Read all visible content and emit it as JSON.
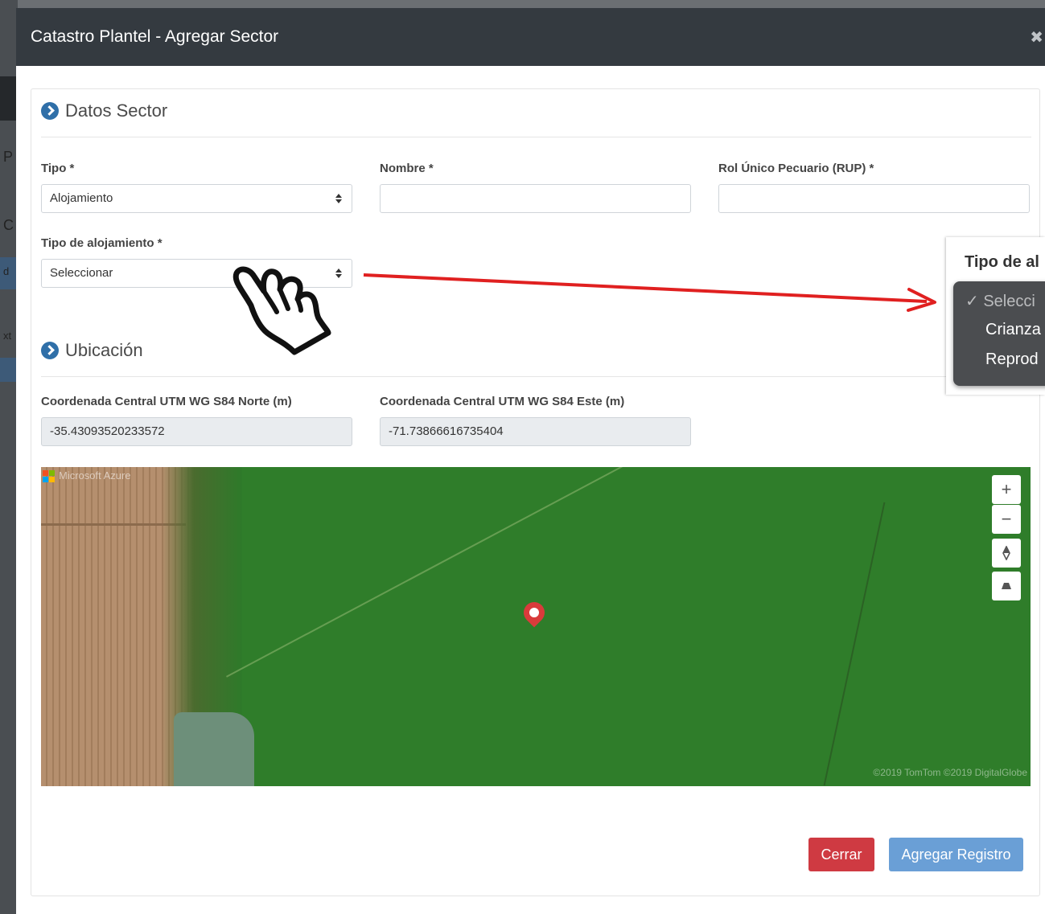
{
  "modal": {
    "title": "Catastro Plantel - Agregar Sector",
    "close_icon": "close-icon",
    "close_glyph": "✖"
  },
  "background": {
    "chars": [
      "P",
      "C",
      "d",
      "xt"
    ]
  },
  "section_datos": {
    "title": "Datos Sector",
    "icon": "chevron-circle-right-icon"
  },
  "fields": {
    "tipo_label": "Tipo *",
    "tipo_value": "Alojamiento",
    "nombre_label": "Nombre *",
    "nombre_value": "",
    "rup_label": "Rol Único Pecuario (RUP) *",
    "rup_value": "",
    "tipo_alojamiento_label": "Tipo de alojamiento *",
    "tipo_alojamiento_value": "Seleccionar"
  },
  "section_ubicacion": {
    "title": "Ubicación",
    "icon": "chevron-circle-right-icon"
  },
  "coords": {
    "norte_label": "Coordenada Central UTM WG S84 Norte (m)",
    "norte_value": "-35.43093520233572",
    "este_label": "Coordenada Central UTM WG S84 Este (m)",
    "este_value": "-71.73866616735404"
  },
  "map": {
    "brand": "Microsoft Azure",
    "copyright": "©2019 TomTom ©2019 DigitalGlobe",
    "zoom_in": "+",
    "zoom_out": "−",
    "compass_icon": "compass-icon",
    "pitch_icon": "pitch-icon",
    "logo_colors": [
      "#f25022",
      "#7fba00",
      "#00a4ef",
      "#ffb900"
    ]
  },
  "buttons": {
    "cerrar": "Cerrar",
    "agregar": "Agregar Registro"
  },
  "callout": {
    "label": "Tipo de al",
    "options": [
      {
        "label": "✓ Selecci",
        "selected": true
      },
      {
        "label": "Crianza",
        "selected": false
      },
      {
        "label": "Reprod",
        "selected": false
      }
    ]
  },
  "colors": {
    "header": "#343a40",
    "accent": "#2f6fa8",
    "danger": "#cf3a42",
    "primary": "#6a9fd6",
    "arrow": "#e02020"
  }
}
